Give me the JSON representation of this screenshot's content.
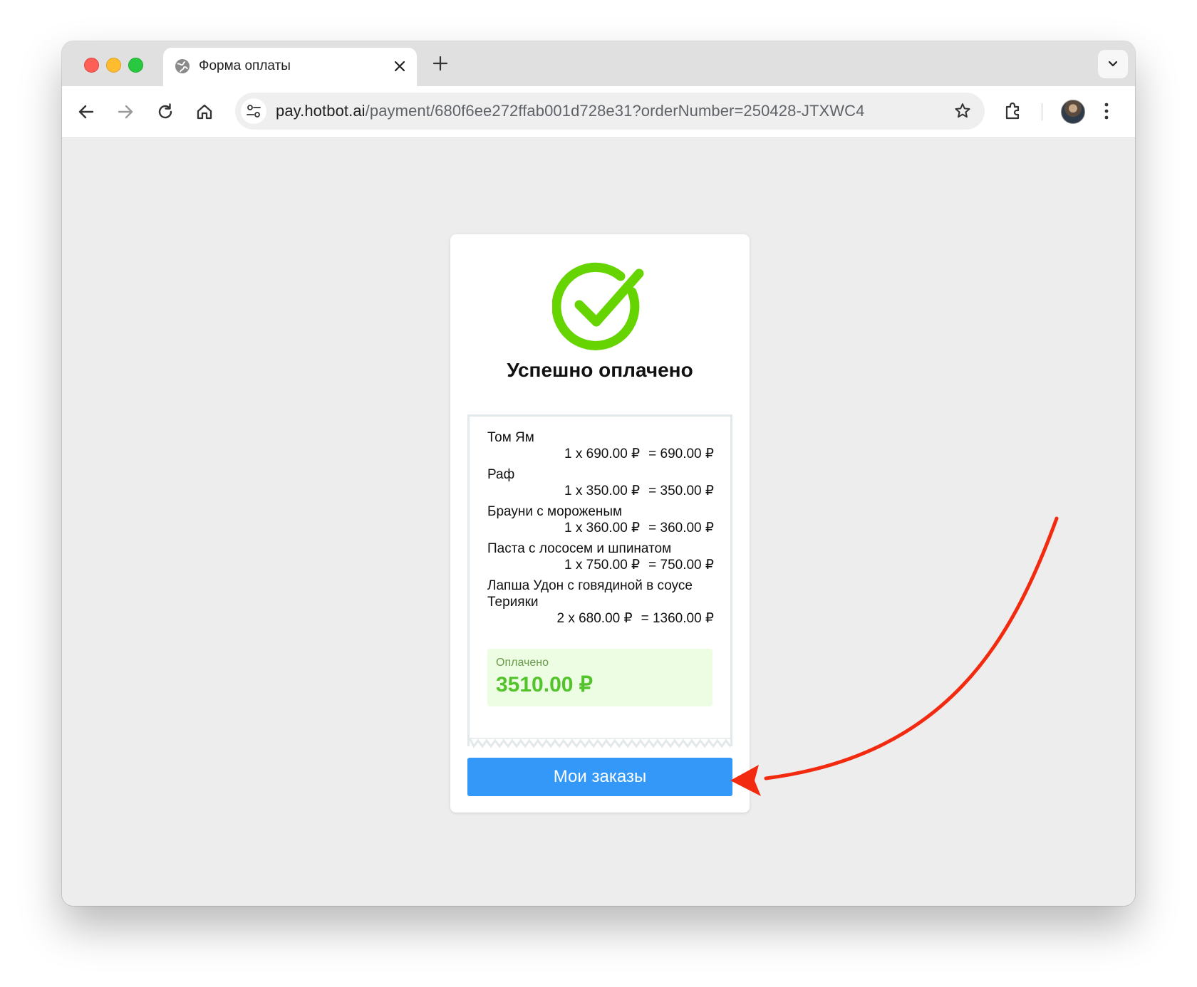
{
  "browser": {
    "tab_title": "Форма оплаты",
    "url_host": "pay.hotbot.ai",
    "url_path": "/payment/680f6ee272ffab001d728e31?orderNumber=250428-JTXWC4"
  },
  "page": {
    "status_title": "Успешно оплачено",
    "items": [
      {
        "name": "Том Ям",
        "calc": "1 x 690.00 ₽",
        "total": "= 690.00 ₽"
      },
      {
        "name": "Раф",
        "calc": "1 x 350.00 ₽",
        "total": "= 350.00 ₽"
      },
      {
        "name": "Брауни с мороженым",
        "calc": "1 x 360.00 ₽",
        "total": "= 360.00 ₽"
      },
      {
        "name": "Паста с лососем и шпинатом",
        "calc": "1 x 750.00 ₽",
        "total": "= 750.00 ₽"
      },
      {
        "name": "Лапша Удон с говядиной в соусе Терияки",
        "calc": "2 x 680.00 ₽",
        "total": "= 1360.00 ₽"
      }
    ],
    "paid_label": "Оплачено",
    "paid_amount": "3510.00 ₽",
    "orders_button": "Мои заказы"
  },
  "colors": {
    "success_green": "#52c32a",
    "button_blue": "#3498f8",
    "annotation_arrow": "#f22a10"
  },
  "icons": [
    "globe-icon",
    "close-icon",
    "plus-icon",
    "chevron-down-icon",
    "back-arrow-icon",
    "forward-arrow-icon",
    "reload-icon",
    "home-icon",
    "site-settings-icon",
    "star-icon",
    "extensions-icon",
    "more-vert-icon",
    "checkmark-circle-icon"
  ]
}
